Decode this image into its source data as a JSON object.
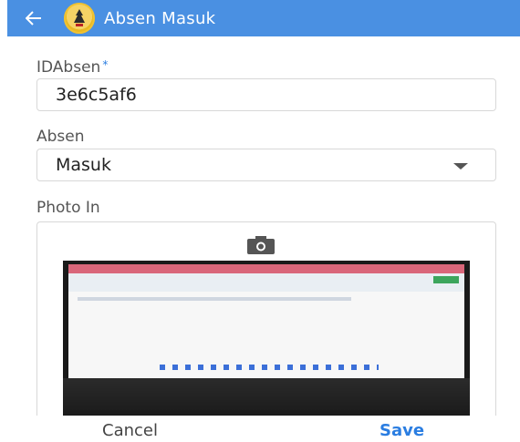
{
  "header": {
    "title": "Absen Masuk",
    "accent": "#4a90e2"
  },
  "form": {
    "id_label": "IDAbsen",
    "required_mark": "*",
    "id_value": "3e6c5af6",
    "absen_label": "Absen",
    "absen_value": "Masuk",
    "photo_label": "Photo In"
  },
  "actions": {
    "cancel": "Cancel",
    "save": "Save"
  }
}
